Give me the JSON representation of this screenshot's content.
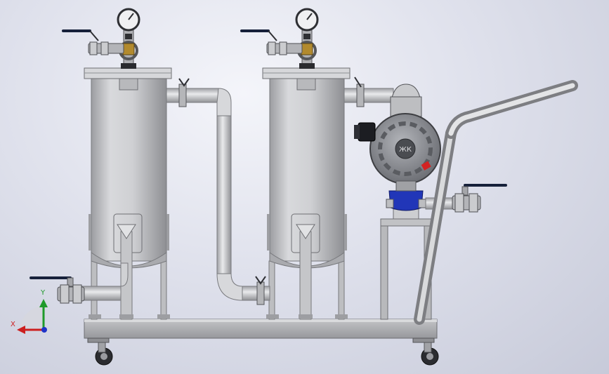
{
  "triad": {
    "x_label": "X",
    "y_label": "Y",
    "x_color": "#cc1f1f",
    "y_color": "#1f9a2a",
    "z_color": "#1f33c8"
  },
  "colors": {
    "steel": "#c9cacc",
    "steel_dark": "#8b8c90",
    "steel_light": "#eeeeef",
    "frame": "#b5b6b9",
    "handle": "#16203a",
    "brass": "#b28a2e",
    "pump_body": "#8c8e94",
    "pump_blue": "#2136b8",
    "indicator_red": "#d32222"
  }
}
